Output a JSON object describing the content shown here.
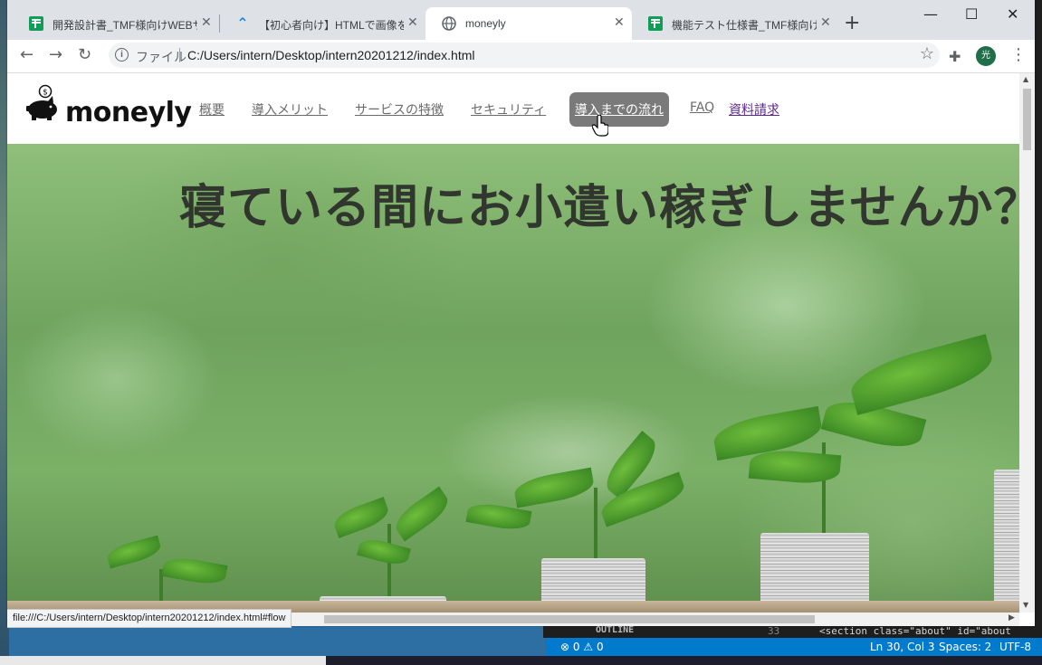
{
  "browser": {
    "tabs": [
      {
        "title": "開発設計書_TMF様向けWEBサイ",
        "icon": "sheets-icon"
      },
      {
        "title": "【初心者向け】HTMLで画像を配置",
        "icon": "qiita-icon"
      },
      {
        "title": "moneyly",
        "icon": "globe-icon"
      },
      {
        "title": "機能テスト仕様書_TMF様向けW",
        "icon": "sheets-icon"
      }
    ],
    "address_scheme": "ファイル",
    "address_url": "C:/Users/intern/Desktop/intern20201212/index.html",
    "profile_initial": "光",
    "status_url": "file:///C:/Users/intern/Desktop/intern20201212/index.html#flow"
  },
  "site": {
    "logo_text": "moneyly",
    "nav": [
      "概要",
      "導入メリット",
      "サービスの特徴",
      "セキュリティ",
      "導入までの流れ",
      "FAQ",
      "資料請求"
    ],
    "hero_title": "寝ている間にお小遣い稼ぎしませんか？"
  },
  "editor": {
    "outline_label": "OUTLINE",
    "line_number": "33",
    "code": "<section class=\"about\" id=\"about",
    "status": {
      "errors": "0",
      "warnings": "0",
      "position": "Ln 30, Col 3",
      "spaces": "Spaces: 2",
      "encoding": "UTF-8"
    }
  },
  "colors": {
    "nav_hover_bg": "#7a7a7a",
    "status_bar": "#007acc",
    "tab_strip": "#dee1e6"
  }
}
